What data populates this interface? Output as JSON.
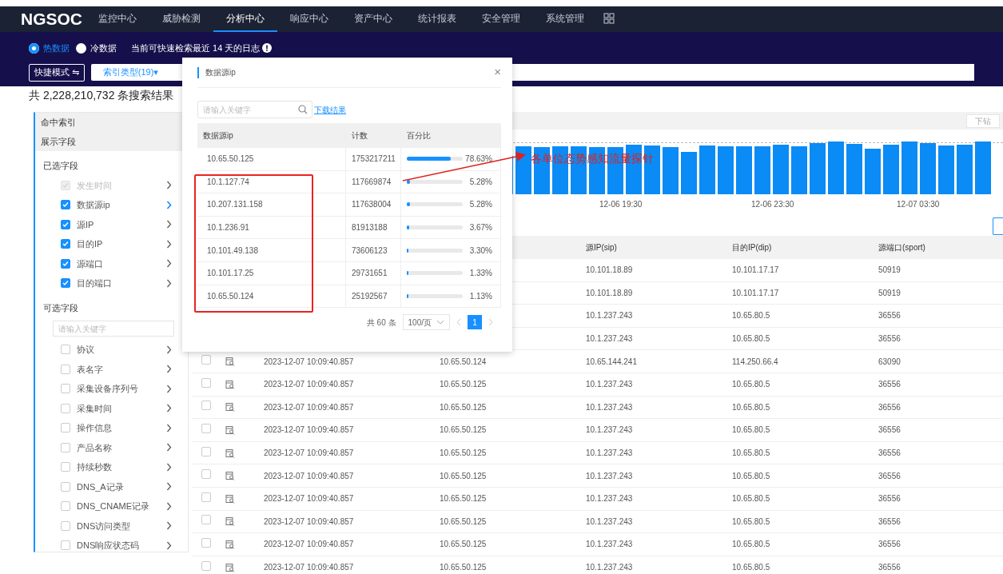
{
  "topnav": {
    "logo": "NGSOC",
    "items": [
      {
        "label": "监控中心",
        "selected": false
      },
      {
        "label": "威胁检测",
        "selected": false
      },
      {
        "label": "分析中心",
        "selected": true
      },
      {
        "label": "响应中心",
        "selected": false
      },
      {
        "label": "资产中心",
        "selected": false
      },
      {
        "label": "统计报表",
        "selected": false
      },
      {
        "label": "安全管理",
        "selected": false
      },
      {
        "label": "系统管理",
        "selected": false
      }
    ]
  },
  "data_source": {
    "options": [
      {
        "label": "热数据",
        "selected": true
      },
      {
        "label": "冷数据",
        "selected": false
      }
    ],
    "notice": "当前可快速检索最近 14 天的日志"
  },
  "toolbar": {
    "mode_button": "快捷模式 ⇋",
    "index_type_button": "索引类型(19)▾"
  },
  "result_count": "共 2,228,210,732 条搜索结果",
  "sidebar": {
    "sections": [
      {
        "label": "命中索引"
      },
      {
        "label": "展示字段"
      }
    ],
    "selected_heading": "已选字段",
    "selected_fields": [
      {
        "label": "发生时间",
        "checked": true,
        "disabled": true,
        "selected": false
      },
      {
        "label": "数据源ip",
        "checked": true,
        "disabled": false,
        "selected": true
      },
      {
        "label": "源IP",
        "checked": true,
        "disabled": false,
        "selected": false
      },
      {
        "label": "目的IP",
        "checked": true,
        "disabled": false,
        "selected": false
      },
      {
        "label": "源端口",
        "checked": true,
        "disabled": false,
        "selected": false
      },
      {
        "label": "目的端口",
        "checked": true,
        "disabled": false,
        "selected": false
      }
    ],
    "optional_heading": "可选字段",
    "search": {
      "placeholder": "请输入关键字"
    },
    "optional_fields": [
      {
        "label": "协议",
        "checked": false,
        "disabled": false,
        "selected": false
      },
      {
        "label": "表名字",
        "checked": false,
        "disabled": false,
        "selected": false
      },
      {
        "label": "采集设备序列号",
        "checked": false,
        "disabled": false,
        "selected": false
      },
      {
        "label": "采集时间",
        "checked": false,
        "disabled": false,
        "selected": false
      },
      {
        "label": "操作信息",
        "checked": false,
        "disabled": false,
        "selected": false
      },
      {
        "label": "产品名称",
        "checked": false,
        "disabled": false,
        "selected": false
      },
      {
        "label": "持续秒数",
        "checked": false,
        "disabled": false,
        "selected": false
      },
      {
        "label": "DNS_A记录",
        "checked": false,
        "disabled": false,
        "selected": false
      },
      {
        "label": "DNS_CNAME记录",
        "checked": false,
        "disabled": false,
        "selected": false
      },
      {
        "label": "DNS访问类型",
        "checked": false,
        "disabled": false,
        "selected": false
      },
      {
        "label": "DNS响应状态码",
        "checked": false,
        "disabled": false,
        "selected": false
      }
    ]
  },
  "chart": {
    "drill_button": "下钻",
    "xlabels": [
      "12-06 19:30",
      "12-06 23:30",
      "12-07 03:30"
    ]
  },
  "table": {
    "columns": {
      "sip": "源IP(sip)",
      "dip": "目的IP(dip)",
      "sport": "源端口(sport)"
    },
    "rows": [
      {
        "sip": "10.101.18.89",
        "dip": "10.101.17.17",
        "sport": "50919"
      },
      {
        "sip": "10.101.18.89",
        "dip": "10.101.17.17",
        "sport": "50919"
      },
      {
        "sip": "10.1.237.243",
        "dip": "10.65.80.5",
        "sport": "36556"
      },
      {
        "sip": "10.1.237.243",
        "dip": "10.65.80.5",
        "sport": "36556"
      },
      {
        "checked": false,
        "time": "2023-12-07 10:09:40.857",
        "data_source_ip": "10.65.50.124",
        "sip": "10.65.144.241",
        "dip": "114.250.66.4",
        "sport": "63090"
      },
      {
        "checked": false,
        "time": "2023-12-07 10:09:40.857",
        "data_source_ip": "10.65.50.125",
        "sip": "10.1.237.243",
        "dip": "10.65.80.5",
        "sport": "36556"
      },
      {
        "checked": false,
        "time": "2023-12-07 10:09:40.857",
        "data_source_ip": "10.65.50.125",
        "sip": "10.1.237.243",
        "dip": "10.65.80.5",
        "sport": "36556"
      },
      {
        "checked": false,
        "time": "2023-12-07 10:09:40.857",
        "data_source_ip": "10.65.50.125",
        "sip": "10.1.237.243",
        "dip": "10.65.80.5",
        "sport": "36556"
      },
      {
        "checked": false,
        "time": "2023-12-07 10:09:40.857",
        "data_source_ip": "10.65.50.125",
        "sip": "10.1.237.243",
        "dip": "10.65.80.5",
        "sport": "36556"
      },
      {
        "checked": false,
        "time": "2023-12-07 10:09:40.857",
        "data_source_ip": "10.65.50.125",
        "sip": "10.1.237.243",
        "dip": "10.65.80.5",
        "sport": "36556"
      },
      {
        "checked": false,
        "time": "2023-12-07 10:09:40.857",
        "data_source_ip": "10.65.50.125",
        "sip": "10.1.237.243",
        "dip": "10.65.80.5",
        "sport": "36556"
      },
      {
        "checked": false,
        "time": "2023-12-07 10:09:40.857",
        "data_source_ip": "10.65.50.125",
        "sip": "10.1.237.243",
        "dip": "10.65.80.5",
        "sport": "36556"
      },
      {
        "checked": false,
        "time": "2023-12-07 10:09:40.857",
        "data_source_ip": "10.65.50.125",
        "sip": "10.1.237.243",
        "dip": "10.65.80.5",
        "sport": "36556"
      },
      {
        "checked": false,
        "time": "2023-12-07 10:09:40.857",
        "data_source_ip": "10.65.50.125",
        "sip": "10.1.237.243",
        "dip": "10.65.80.5",
        "sport": "36556"
      }
    ]
  },
  "modal": {
    "title": "数据源ip",
    "close": "×",
    "search": {
      "placeholder": "请输入关键字"
    },
    "download_link": "下载结果",
    "columns": [
      "数据源ip",
      "计数",
      "百分比"
    ],
    "rows": [
      {
        "ip": "10.65.50.125",
        "count": "1753217211",
        "level": 0.7863,
        "percent": "78.63%"
      },
      {
        "ip": "10.1.127.74",
        "count": "117669874",
        "level": 0.0528,
        "percent": "5.28%"
      },
      {
        "ip": "10.207.131.158",
        "count": "117638004",
        "level": 0.0528,
        "percent": "5.28%"
      },
      {
        "ip": "10.1.236.91",
        "count": "81913188",
        "level": 0.0367,
        "percent": "3.67%"
      },
      {
        "ip": "10.101.49.138",
        "count": "73606123",
        "level": 0.033,
        "percent": "3.30%"
      },
      {
        "ip": "10.101.17.25",
        "count": "29731651",
        "level": 0.0133,
        "percent": "1.33%"
      },
      {
        "ip": "10.65.50.124",
        "count": "25192567",
        "level": 0.0113,
        "percent": "1.13%"
      }
    ],
    "pagination": {
      "total": "共 60 条",
      "page_size": "100/页",
      "pages": [
        {
          "label": "1",
          "selected": true
        }
      ]
    }
  },
  "annotation": {
    "text": "各单位态势感知流量探针"
  }
}
